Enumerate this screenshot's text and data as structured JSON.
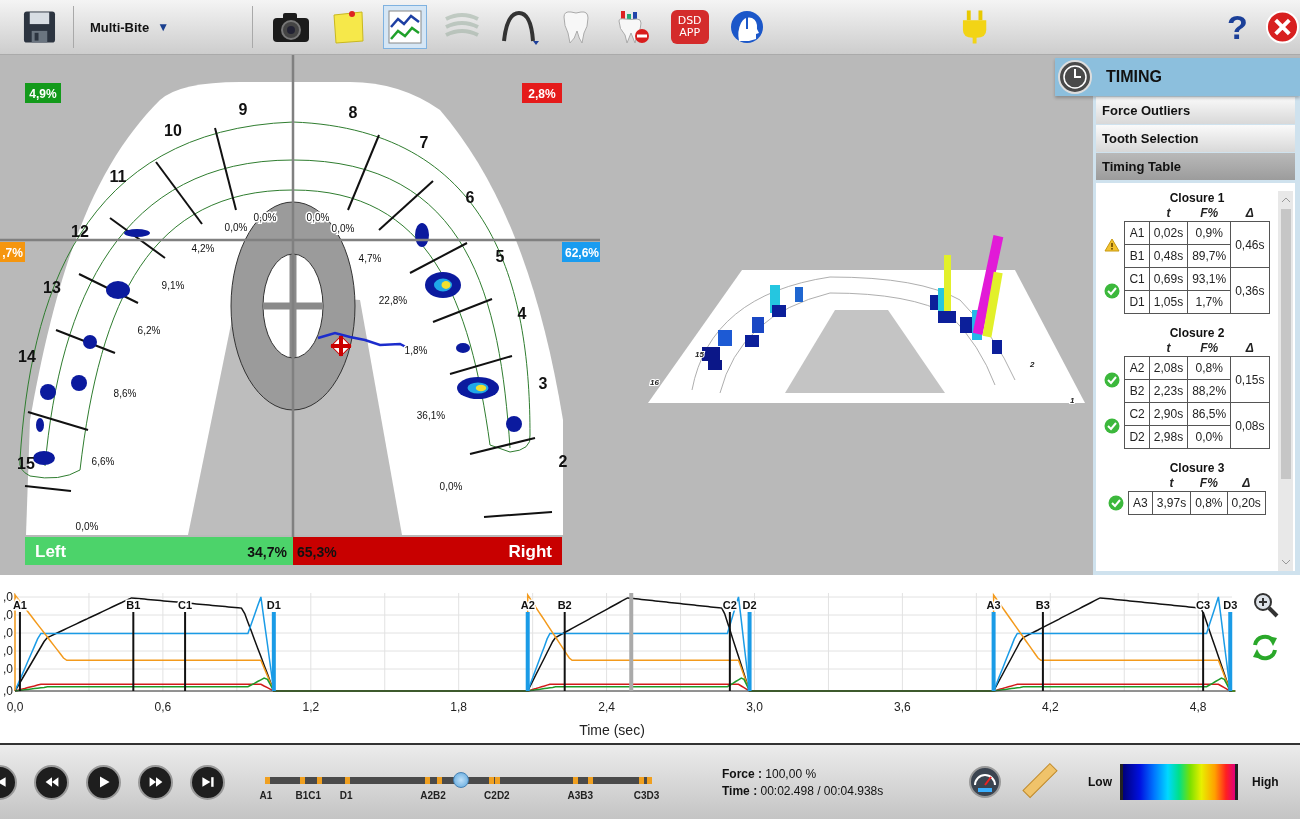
{
  "toolbar": {
    "mode_dropdown": {
      "label": "Multi-Bite",
      "caret": "▼"
    },
    "tools": [
      {
        "kind": "camera",
        "selected": false,
        "disabled": false
      },
      {
        "kind": "note",
        "selected": false,
        "disabled": false
      },
      {
        "kind": "chart",
        "selected": true,
        "disabled": false
      },
      {
        "kind": "layers",
        "selected": false,
        "disabled": true
      },
      {
        "kind": "arch",
        "selected": false,
        "disabled": false
      },
      {
        "kind": "tooth",
        "selected": false,
        "disabled": false
      },
      {
        "kind": "tooth-remove",
        "selected": false,
        "disabled": false
      },
      {
        "kind": "logo",
        "selected": false,
        "disabled": false,
        "text": [
          "DSD",
          "APP"
        ]
      },
      {
        "kind": "head",
        "selected": false,
        "disabled": false
      }
    ],
    "help": "?"
  },
  "arch_2d": {
    "badges": [
      {
        "text": "4,9%",
        "color": "#139a1b"
      },
      {
        "text": "2,8%",
        "color": "#e51b1b"
      },
      {
        "text": ",7%",
        "color": "#f5960f"
      },
      {
        "text": "62,6%",
        "color": "#1a9cf0"
      }
    ],
    "tooth_numbers": [
      "9",
      "8",
      "10",
      "7",
      "11",
      "6",
      "12",
      "5",
      "13",
      "4",
      "14",
      "3",
      "15",
      "2"
    ],
    "percentages": [
      "0,0%",
      "0,0%",
      "0,0%",
      "0,0%",
      "4,2%",
      "4,7%",
      "9,1%",
      "22,8%",
      "6,2%",
      "1,8%",
      "8,6%",
      "36,1%",
      "6,6%",
      "0,0%",
      "0,0%"
    ],
    "left_share": {
      "label": "Left",
      "value": "34,7%"
    },
    "right_share": {
      "label": "Right",
      "value": "65,3%"
    }
  },
  "arch_3d": {
    "tooth_numbers": [
      "15",
      "16",
      "2",
      "1"
    ]
  },
  "timing_panel": {
    "title": "TIMING",
    "sections": [
      {
        "label": "Force Outliers",
        "expanded": false
      },
      {
        "label": "Tooth Selection",
        "expanded": false
      },
      {
        "label": "Timing Table",
        "expanded": true
      }
    ],
    "closures": [
      {
        "title": "Closure 1",
        "columns": [
          "t",
          "F%",
          "Δ"
        ],
        "pairs": [
          {
            "kind": "warning",
            "delta": "0,46s",
            "rows": [
              {
                "label": "A1",
                "t": "0,02s",
                "f": "0,9%"
              },
              {
                "label": "B1",
                "t": "0,48s",
                "f": "89,7%"
              }
            ]
          },
          {
            "kind": "ok",
            "delta": "0,36s",
            "rows": [
              {
                "label": "C1",
                "t": "0,69s",
                "f": "93,1%"
              },
              {
                "label": "D1",
                "t": "1,05s",
                "f": "1,7%"
              }
            ]
          }
        ]
      },
      {
        "title": "Closure 2",
        "columns": [
          "t",
          "F%",
          "Δ"
        ],
        "pairs": [
          {
            "kind": "ok",
            "delta": "0,15s",
            "rows": [
              {
                "label": "A2",
                "t": "2,08s",
                "f": "0,8%"
              },
              {
                "label": "B2",
                "t": "2,23s",
                "f": "88,2%"
              }
            ]
          },
          {
            "kind": "ok",
            "delta": "0,08s",
            "rows": [
              {
                "label": "C2",
                "t": "2,90s",
                "f": "86,5%"
              },
              {
                "label": "D2",
                "t": "2,98s",
                "f": "0,0%"
              }
            ]
          }
        ]
      },
      {
        "title": "Closure 3",
        "columns": [
          "t",
          "F%",
          "Δ"
        ],
        "pairs": [
          {
            "kind": "ok",
            "delta": "0,20s",
            "rows": [
              {
                "label": "A3",
                "t": "3,97s",
                "f": "0,8%"
              }
            ]
          }
        ]
      }
    ]
  },
  "graph": {
    "y_labels": [
      ",0",
      ",0",
      ",0",
      ",0",
      ",0",
      ",0"
    ],
    "x_ticks": [
      "0,0",
      "0,6",
      "1,2",
      "1,8",
      "2,4",
      "3,0",
      "3,6",
      "4,2",
      "4,8"
    ],
    "xlabel": "Time (sec)",
    "markers": [
      "A1",
      "B1",
      "C1",
      "D1",
      "A2",
      "B2",
      "C2",
      "D2",
      "A3",
      "B3",
      "C3",
      "D3"
    ]
  },
  "player": {
    "timeline": {
      "level": 0.51,
      "labels": [
        "A1",
        "B1C1",
        "D1",
        "A2B2",
        "C2D2",
        "A3B3",
        "C3D3"
      ]
    },
    "force": "**Force :** 100,00 %",
    "time": "**Time :** 00:02.498 / 00:04.938s",
    "legend": {
      "low": "Low",
      "high": "High"
    }
  }
}
